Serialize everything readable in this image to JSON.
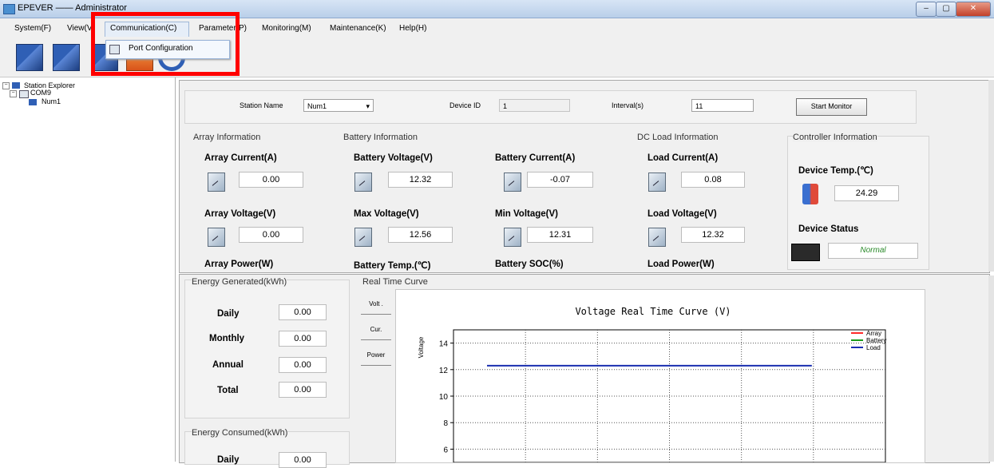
{
  "window": {
    "title": "EPEVER —— Administrator",
    "min_label": "–",
    "max_label": "▢",
    "close_label": "✕"
  },
  "menu": {
    "items": [
      "System(F)",
      "View(V)",
      "Communication(C)",
      "Parameter(P)",
      "Monitoring(M)",
      "Maintenance(K)",
      "Help(H)"
    ]
  },
  "dropdown": {
    "item": "Port Configuration"
  },
  "tree": {
    "root": "Station Explorer",
    "port": "COM9",
    "device": "Num1"
  },
  "station": {
    "name_label": "Station Name",
    "name_value": "Num1",
    "device_id_label": "Device ID",
    "device_id_value": "1",
    "interval_label": "Interval(s)",
    "interval_value": "11",
    "start_button": "Start Monitor"
  },
  "array": {
    "title": "Array Information",
    "current_label": "Array Current(A)",
    "current_value": "0.00",
    "voltage_label": "Array Voltage(V)",
    "voltage_value": "0.00",
    "power_label": "Array Power(W)"
  },
  "battery": {
    "title": "Battery Information",
    "voltage_label": "Battery Voltage(V)",
    "voltage_value": "12.32",
    "current_label": "Battery Current(A)",
    "current_value": "-0.07",
    "max_label": "Max Voltage(V)",
    "max_value": "12.56",
    "min_label": "Min Voltage(V)",
    "min_value": "12.31",
    "temp_label": "Battery Temp.(℃)",
    "soc_label": "Battery SOC(%)"
  },
  "load": {
    "title": "DC Load Information",
    "current_label": "Load Current(A)",
    "current_value": "0.08",
    "voltage_label": "Load Voltage(V)",
    "voltage_value": "12.32",
    "power_label": "Load Power(W)"
  },
  "controller": {
    "title": "Controller Information",
    "temp_label": "Device Temp.(℃)",
    "temp_value": "24.29",
    "status_label": "Device Status",
    "status_value": "Normal"
  },
  "energy_generated": {
    "title": "Energy Generated(kWh)",
    "rows": [
      {
        "label": "Daily",
        "value": "0.00"
      },
      {
        "label": "Monthly",
        "value": "0.00"
      },
      {
        "label": "Annual",
        "value": "0.00"
      },
      {
        "label": "Total",
        "value": "0.00"
      }
    ]
  },
  "energy_consumed": {
    "title": "Energy Consumed(kWh)",
    "rows": [
      {
        "label": "Daily",
        "value": "0.00"
      }
    ]
  },
  "curve": {
    "section_title": "Real Time Curve",
    "buttons": [
      "Volt .",
      "Cur.",
      "Power"
    ]
  },
  "colors": {
    "array": "#ff2a2a",
    "battery": "#1a9a1a",
    "load": "#1a2fb0",
    "highlight_box": "#ff0000"
  },
  "chart_data": {
    "type": "line",
    "title": "Voltage Real Time Curve (V)",
    "ylabel": "Voltage",
    "xlabel": "",
    "ylim": [
      5,
      15
    ],
    "yticks": [
      6,
      8,
      10,
      12,
      14
    ],
    "grid": true,
    "legend_position": "top-right",
    "x": [
      0,
      1
    ],
    "series": [
      {
        "name": "Array",
        "color": "#ff2a2a",
        "values": []
      },
      {
        "name": "Battery",
        "color": "#1a9a1a",
        "values": []
      },
      {
        "name": "Load",
        "color": "#1a2fb0",
        "values": [
          12.3,
          12.3
        ]
      }
    ]
  }
}
